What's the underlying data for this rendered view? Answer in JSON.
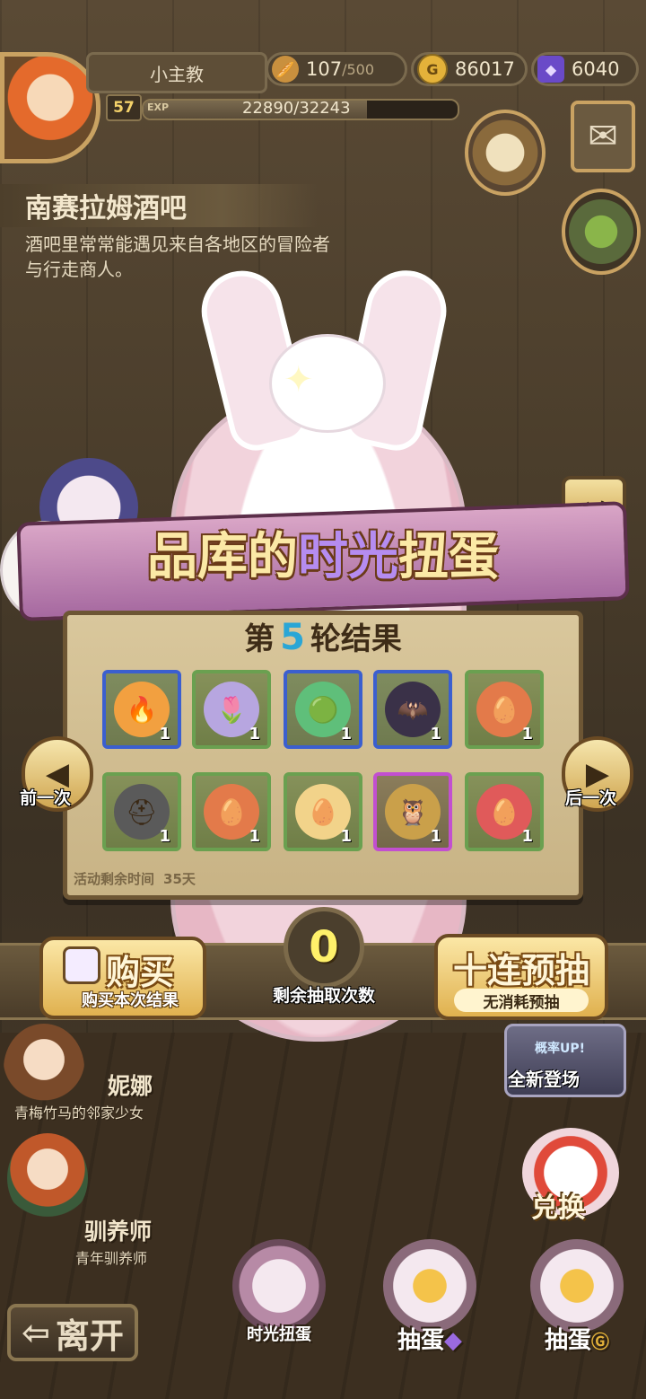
{
  "player": {
    "name": "小主教",
    "level": "57",
    "exp_tag": "EXP",
    "exp_text": "22890/32243",
    "exp_fraction": 0.71
  },
  "resources": {
    "stamina": "107",
    "stamina_max": "/500",
    "gold": "86017",
    "gold_icon_letter": "G",
    "gems": "6040"
  },
  "location": {
    "title": "南赛拉姆酒吧",
    "description": "酒吧里常常能遇见来自各地区的冒险者与行走商人。"
  },
  "banner": {
    "title_a": "品库的",
    "title_b": "时光",
    "title_c": "扭蛋"
  },
  "results": {
    "round_prefix": "第",
    "round_number": "5",
    "round_suffix": "轮结果",
    "items": [
      {
        "icon": "fire-swirl-icon",
        "glyph": "🔥",
        "rarity": "blue",
        "count": "1"
      },
      {
        "icon": "lavender-bud-icon",
        "glyph": "🌷",
        "rarity": "green",
        "count": "1"
      },
      {
        "icon": "green-slime-icon",
        "glyph": "🟢",
        "rarity": "blue",
        "count": "1"
      },
      {
        "icon": "dark-bat-icon",
        "glyph": "🦇",
        "rarity": "blue",
        "count": "1"
      },
      {
        "icon": "flame-egg-icon",
        "glyph": "🥚",
        "rarity": "green",
        "count": "1"
      },
      {
        "icon": "iron-helmet-icon",
        "glyph": "⛑",
        "rarity": "green",
        "count": "1"
      },
      {
        "icon": "flame-egg-icon",
        "glyph": "🥚",
        "rarity": "green",
        "count": "1"
      },
      {
        "icon": "bandaged-egg-icon",
        "glyph": "🥚",
        "rarity": "green",
        "count": "1"
      },
      {
        "icon": "golden-owl-icon",
        "glyph": "🦉",
        "rarity": "purple",
        "count": "1"
      },
      {
        "icon": "red-swirl-egg-icon",
        "glyph": "🥚",
        "rarity": "green",
        "count": "1"
      }
    ],
    "time_label": "活动剩余时间",
    "time_value": "35天"
  },
  "nav": {
    "prev": "前一次",
    "next": "后一次"
  },
  "actions": {
    "buy_main": "购买",
    "buy_sub": "购买本次结果",
    "remaining_count": "0",
    "remaining_label": "剩余抽取次数",
    "ten_main": "十连预抽",
    "ten_sub": "无消耗预抽"
  },
  "characters": [
    {
      "name": "妮娜",
      "desc": "青梅竹马的邻家少女"
    },
    {
      "name": "驯养师",
      "desc": "青年驯养师"
    }
  ],
  "side": {
    "badge_top": "概率UP!",
    "badge_label": "全新登场",
    "exchange": "兑换"
  },
  "dock": {
    "leave": "离开",
    "items": [
      {
        "label": "时光扭蛋"
      },
      {
        "label": "抽蛋"
      },
      {
        "label": "抽蛋"
      }
    ]
  },
  "colors": {
    "rarity_green": "#6aa050",
    "rarity_blue": "#3b5fcf",
    "rarity_purple": "#c24fd0",
    "accent_gold": "#e0b14f",
    "round_number": "#2aa6d6"
  }
}
